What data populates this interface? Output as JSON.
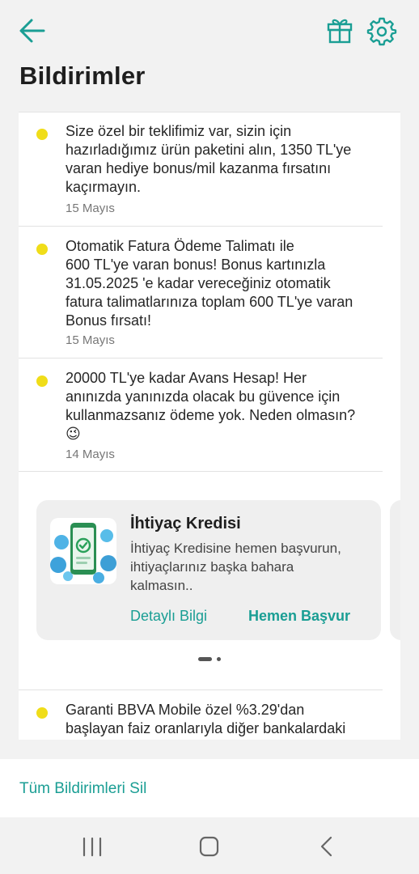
{
  "header": {
    "title": "Bildirimler",
    "back_icon": "arrow-left-icon",
    "gift_icon": "gift-icon",
    "settings_icon": "gear-icon",
    "accent_color": "#1a9e94"
  },
  "notifications": [
    {
      "lines": [
        "Size özel bir teklifimiz var, sizin için",
        "hazırladığımız ürün paketini alın, 1350 TL'ye",
        "varan hediye bonus/mil kazanma fırsatını",
        "kaçırmayın."
      ],
      "date": "15 Mayıs",
      "unread": true
    },
    {
      "lines": [
        "Otomatik Fatura Ödeme Talimatı ile",
        "600 TL'ye varan bonus! Bonus kartınızla",
        "31.05.2025 'e kadar vereceğiniz otomatik",
        "fatura talimatlarınıza toplam 600 TL'ye varan",
        "Bonus fırsatı!"
      ],
      "date": "15 Mayıs",
      "unread": true
    },
    {
      "lines": [
        "20000 TL'ye kadar Avans Hesap! Her",
        "anınızda yanınızda olacak bu güvence için",
        "kullanmazsanız ödeme yok. Neden olmasın?",
        "😉"
      ],
      "date": "14 Mayıs",
      "unread": true
    },
    {
      "lines": [
        "Garanti BBVA Mobile özel %3.29'dan",
        "başlayan faiz oranlarıyla diğer bankalardaki"
      ],
      "date": "",
      "unread": true
    }
  ],
  "promo": {
    "title": "İhtiyaç Kredisi",
    "description_lines": [
      "İhtiyaç Kredisine hemen başvurun,",
      "ihtiyaçlarınız başka bahara",
      "kalmasın.."
    ],
    "details_label": "Detaylı Bilgi",
    "apply_label": "Hemen Başvur",
    "image_icon": "phone-approval-illustration",
    "active_slide": 1,
    "slide_count": 2
  },
  "footer": {
    "delete_all_label": "Tüm Bildirimleri Sil"
  },
  "system_nav": {
    "recents_icon": "recents-icon",
    "home_icon": "home-icon",
    "back_icon": "system-back-icon"
  }
}
